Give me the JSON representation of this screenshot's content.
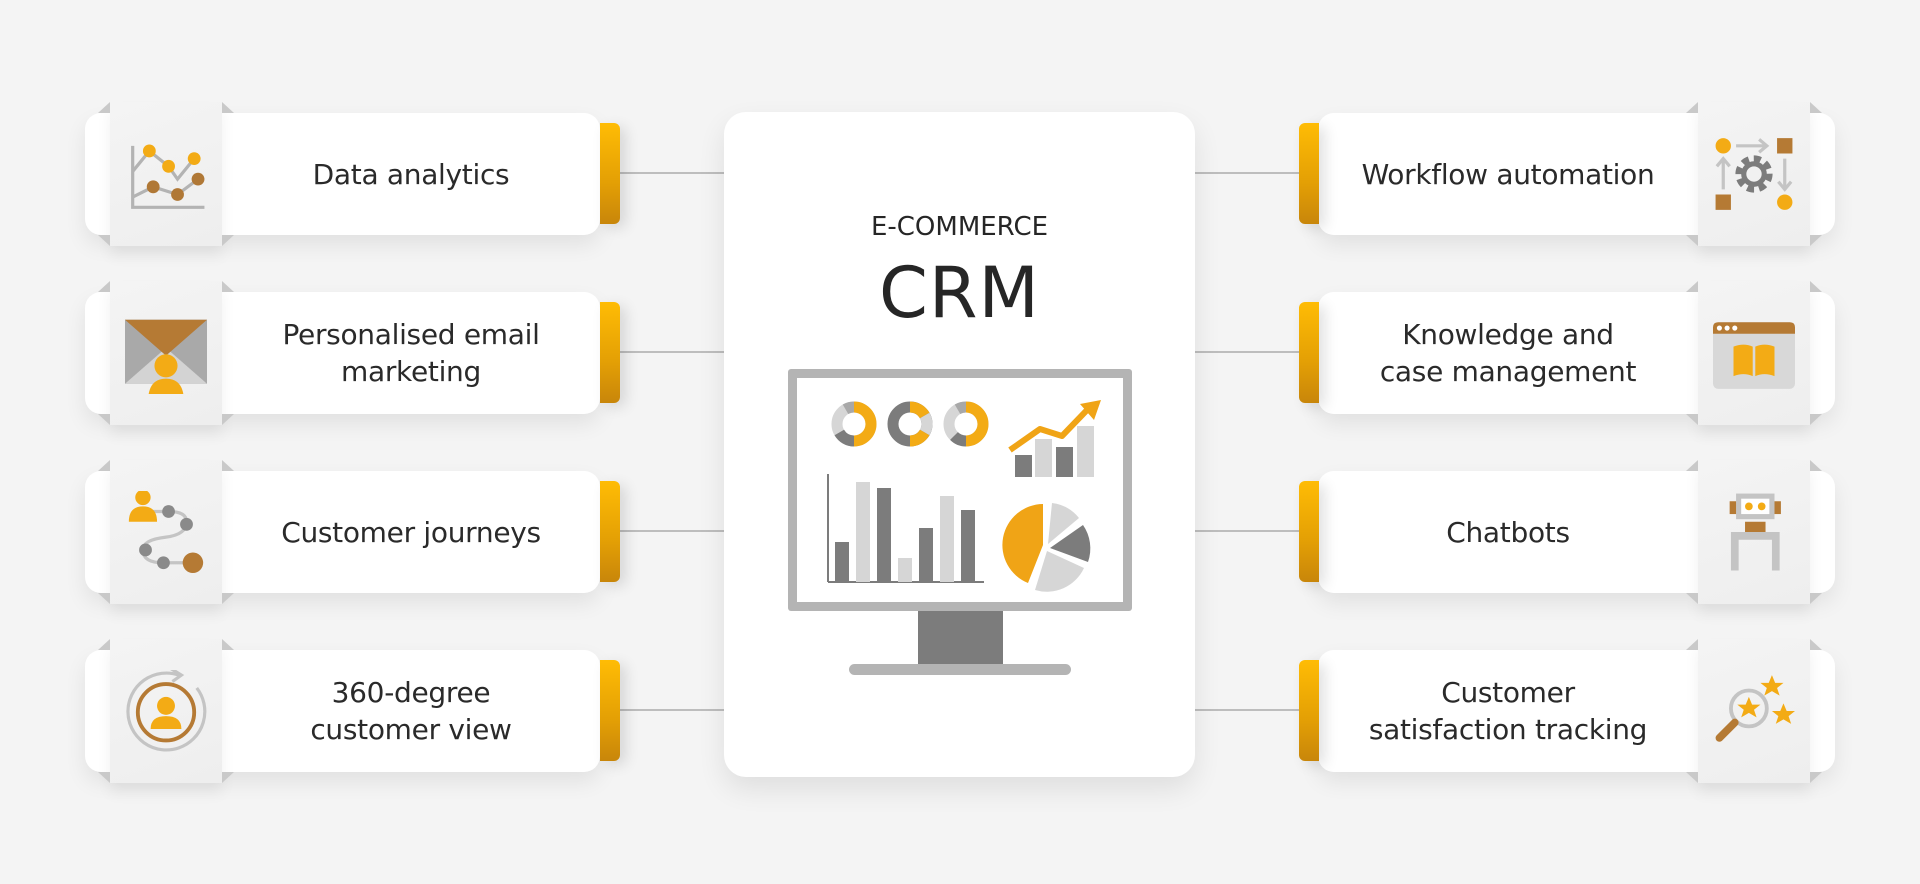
{
  "center": {
    "subtitle": "E-COMMERCE",
    "title": "CRM",
    "illustration": "monitor-dashboard-icon"
  },
  "colors": {
    "background": "#f4f4f4",
    "card": "#ffffff",
    "accent_yellow": "#f5b014",
    "accent_brown": "#b57a34",
    "gray_dark": "#7a7a7a",
    "gray_light": "#d6d6d6",
    "text": "#2a2a2a",
    "connector": "#bdbdbd"
  },
  "left_features": [
    {
      "label": "Data analytics",
      "icon": "line-chart-icon"
    },
    {
      "label": "Personalised email\nmarketing",
      "icon": "email-person-icon"
    },
    {
      "label": "Customer journeys",
      "icon": "journey-path-icon"
    },
    {
      "label": "360-degree\ncustomer view",
      "icon": "rotate-person-icon"
    }
  ],
  "right_features": [
    {
      "label": "Workflow automation",
      "icon": "workflow-gear-icon"
    },
    {
      "label": "Knowledge and\ncase management",
      "icon": "browser-book-icon"
    },
    {
      "label": "Chatbots",
      "icon": "robot-icon"
    },
    {
      "label": "Customer\nsatisfaction tracking",
      "icon": "magnifier-stars-icon"
    }
  ]
}
